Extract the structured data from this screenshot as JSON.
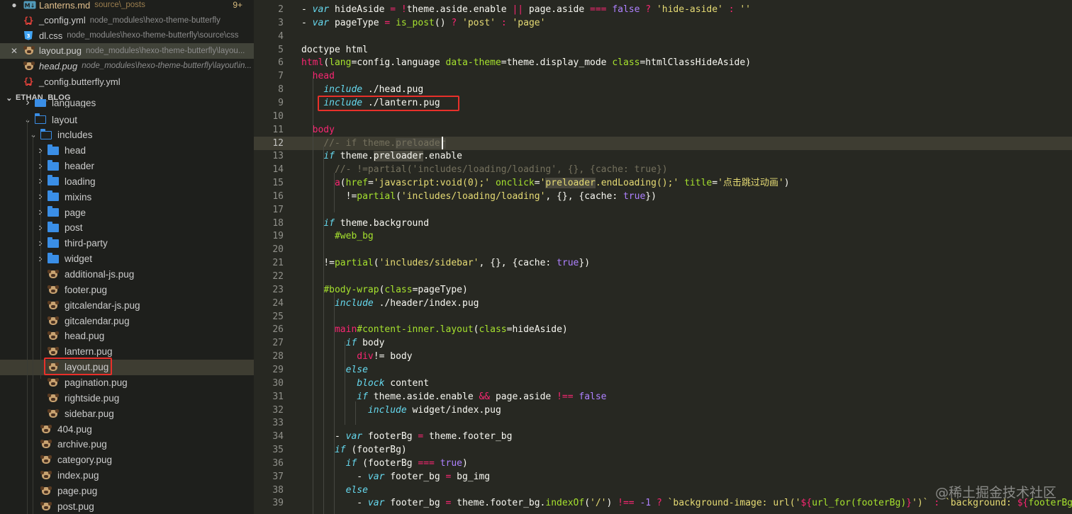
{
  "colors": {
    "sidebar_bg": "#1e1f1c",
    "editor_bg": "#272822",
    "highlight_box": "#e8302a",
    "folder": "#3a8ee6"
  },
  "open_editors": [
    {
      "name": "Lanterns.md",
      "desc": "source\\_posts",
      "badge": "9+",
      "icon": "markdown-icon",
      "lead": "●",
      "modified": true
    },
    {
      "name": "_config.yml",
      "desc": "node_modules\\hexo-theme-butterfly",
      "icon": "yaml-icon"
    },
    {
      "name": "dl.css",
      "desc": "node_modules\\hexo-theme-butterfly\\source\\css",
      "icon": "css-icon"
    },
    {
      "name": "layout.pug",
      "desc": "node_modules\\hexo-theme-butterfly\\layou...",
      "icon": "pug-icon",
      "lead": "✕",
      "active": true
    },
    {
      "name": "head.pug",
      "desc": "node_modules\\hexo-theme-butterfly\\layout\\in...",
      "icon": "pug-icon",
      "italic": true
    },
    {
      "name": "_config.butterfly.yml",
      "desc": "",
      "icon": "yaml-icon"
    }
  ],
  "project_header": "ETHAN_BLOG",
  "tree": [
    {
      "label": "languages",
      "type": "folder",
      "depth": 2,
      "partial": true
    },
    {
      "label": "layout",
      "type": "folder",
      "depth": 2,
      "open": true
    },
    {
      "label": "includes",
      "type": "folder",
      "depth": 3,
      "open": true
    },
    {
      "label": "head",
      "type": "folder",
      "depth": 4
    },
    {
      "label": "header",
      "type": "folder",
      "depth": 4
    },
    {
      "label": "loading",
      "type": "folder",
      "depth": 4
    },
    {
      "label": "mixins",
      "type": "folder",
      "depth": 4
    },
    {
      "label": "page",
      "type": "folder",
      "depth": 4
    },
    {
      "label": "post",
      "type": "folder",
      "depth": 4
    },
    {
      "label": "third-party",
      "type": "folder",
      "depth": 4
    },
    {
      "label": "widget",
      "type": "folder",
      "depth": 4
    },
    {
      "label": "additional-js.pug",
      "type": "pug",
      "depth": 4
    },
    {
      "label": "footer.pug",
      "type": "pug",
      "depth": 4
    },
    {
      "label": "gitcalendar-js.pug",
      "type": "pug",
      "depth": 4
    },
    {
      "label": "gitcalendar.pug",
      "type": "pug",
      "depth": 4
    },
    {
      "label": "head.pug",
      "type": "pug",
      "depth": 4
    },
    {
      "label": "lantern.pug",
      "type": "pug",
      "depth": 4
    },
    {
      "label": "layout.pug",
      "type": "pug",
      "depth": 4,
      "selected": true
    },
    {
      "label": "pagination.pug",
      "type": "pug",
      "depth": 4
    },
    {
      "label": "rightside.pug",
      "type": "pug",
      "depth": 4
    },
    {
      "label": "sidebar.pug",
      "type": "pug",
      "depth": 4
    },
    {
      "label": "404.pug",
      "type": "pug",
      "depth": 3
    },
    {
      "label": "archive.pug",
      "type": "pug",
      "depth": 3
    },
    {
      "label": "category.pug",
      "type": "pug",
      "depth": 3
    },
    {
      "label": "index.pug",
      "type": "pug",
      "depth": 3
    },
    {
      "label": "page.pug",
      "type": "pug",
      "depth": 3
    },
    {
      "label": "post.pug",
      "type": "pug",
      "depth": 3
    }
  ],
  "editor": {
    "current_line": 12,
    "lines": [
      {
        "n": 2,
        "tokens": [
          [
            "- ",
            ""
          ],
          [
            "var",
            "k"
          ],
          [
            " hideAside ",
            ""
          ],
          [
            "=",
            "op"
          ],
          [
            " ",
            ""
          ],
          [
            "!",
            "op"
          ],
          [
            "theme.aside.enable ",
            ""
          ],
          [
            "||",
            "op"
          ],
          [
            " page.aside ",
            ""
          ],
          [
            "===",
            "op"
          ],
          [
            " ",
            ""
          ],
          [
            "false",
            "n"
          ],
          [
            " ",
            ""
          ],
          [
            "?",
            "op"
          ],
          [
            " ",
            ""
          ],
          [
            "'hide-aside'",
            "s"
          ],
          [
            " ",
            ""
          ],
          [
            ":",
            "op"
          ],
          [
            " ",
            ""
          ],
          [
            "''",
            "s"
          ]
        ]
      },
      {
        "n": 3,
        "tokens": [
          [
            "- ",
            ""
          ],
          [
            "var",
            "k"
          ],
          [
            " pageType ",
            ""
          ],
          [
            "=",
            "op"
          ],
          [
            " ",
            ""
          ],
          [
            "is_post",
            "a"
          ],
          [
            "() ",
            ""
          ],
          [
            "?",
            "op"
          ],
          [
            " ",
            ""
          ],
          [
            "'post'",
            "s"
          ],
          [
            " ",
            ""
          ],
          [
            ":",
            "op"
          ],
          [
            " ",
            ""
          ],
          [
            "'page'",
            "s"
          ]
        ]
      },
      {
        "n": 4,
        "tokens": []
      },
      {
        "n": 5,
        "tokens": [
          [
            "doctype html",
            ""
          ]
        ]
      },
      {
        "n": 6,
        "tokens": [
          [
            "html",
            "t"
          ],
          [
            "(",
            ""
          ],
          [
            "lang",
            "a"
          ],
          [
            "=config.language ",
            ""
          ],
          [
            "data-theme",
            "a"
          ],
          [
            "=theme.display_mode ",
            ""
          ],
          [
            "class",
            "a"
          ],
          [
            "=htmlClassHideAside)",
            ""
          ]
        ]
      },
      {
        "n": 7,
        "tokens": [
          [
            "  ",
            ""
          ],
          [
            "head",
            "t"
          ]
        ]
      },
      {
        "n": 8,
        "tokens": [
          [
            "    ",
            ""
          ],
          [
            "include",
            "k"
          ],
          [
            " ./head.pug",
            ""
          ]
        ]
      },
      {
        "n": 9,
        "tokens": [
          [
            "    ",
            ""
          ],
          [
            "include",
            "k"
          ],
          [
            " ./lantern.pug",
            ""
          ]
        ]
      },
      {
        "n": 10,
        "tokens": []
      },
      {
        "n": 11,
        "tokens": [
          [
            "  ",
            ""
          ],
          [
            "body",
            "t"
          ]
        ]
      },
      {
        "n": 12,
        "tokens": [
          [
            "    ",
            ""
          ],
          [
            "//- if theme.",
            "c"
          ],
          [
            "preloader",
            "c hl"
          ]
        ]
      },
      {
        "n": 13,
        "tokens": [
          [
            "    ",
            ""
          ],
          [
            "if",
            "k"
          ],
          [
            " theme.",
            ""
          ],
          [
            "preloader",
            "hl"
          ],
          [
            ".enable",
            ""
          ]
        ]
      },
      {
        "n": 14,
        "tokens": [
          [
            "      ",
            ""
          ],
          [
            "//- !=partial('includes/loading/loading', {}, {cache: true})",
            "c"
          ]
        ]
      },
      {
        "n": 15,
        "tokens": [
          [
            "      ",
            ""
          ],
          [
            "a",
            "t"
          ],
          [
            "(",
            ""
          ],
          [
            "href",
            "a"
          ],
          [
            "=",
            ""
          ],
          [
            "'javascript:void(0);'",
            "s"
          ],
          [
            " ",
            ""
          ],
          [
            "onclick",
            "a"
          ],
          [
            "=",
            ""
          ],
          [
            "'",
            "s"
          ],
          [
            "preloader",
            "s hl"
          ],
          [
            ".endLoading();'",
            "s"
          ],
          [
            " ",
            ""
          ],
          [
            "title",
            "a"
          ],
          [
            "=",
            ""
          ],
          [
            "'点击跳过动画'",
            "s"
          ],
          [
            ")",
            ""
          ]
        ]
      },
      {
        "n": 16,
        "tokens": [
          [
            "        ",
            ""
          ],
          [
            "!=",
            ""
          ],
          [
            "partial",
            "a"
          ],
          [
            "(",
            ""
          ],
          [
            "'includes/loading/loading'",
            "s"
          ],
          [
            ", {}, {cache: ",
            ""
          ],
          [
            "true",
            "n"
          ],
          [
            "})",
            ""
          ]
        ]
      },
      {
        "n": 17,
        "tokens": []
      },
      {
        "n": 18,
        "tokens": [
          [
            "    ",
            ""
          ],
          [
            "if",
            "k"
          ],
          [
            " theme.background",
            ""
          ]
        ]
      },
      {
        "n": 19,
        "tokens": [
          [
            "      ",
            ""
          ],
          [
            "#web_bg",
            "a"
          ]
        ]
      },
      {
        "n": 20,
        "tokens": []
      },
      {
        "n": 21,
        "tokens": [
          [
            "    ",
            ""
          ],
          [
            "!=",
            ""
          ],
          [
            "partial",
            "a"
          ],
          [
            "(",
            ""
          ],
          [
            "'includes/sidebar'",
            "s"
          ],
          [
            ", {}, {cache: ",
            ""
          ],
          [
            "true",
            "n"
          ],
          [
            "})",
            ""
          ]
        ]
      },
      {
        "n": 22,
        "tokens": []
      },
      {
        "n": 23,
        "tokens": [
          [
            "    ",
            ""
          ],
          [
            "#body-wrap",
            "a"
          ],
          [
            "(",
            ""
          ],
          [
            "class",
            "a"
          ],
          [
            "=pageType)",
            ""
          ]
        ]
      },
      {
        "n": 24,
        "tokens": [
          [
            "      ",
            ""
          ],
          [
            "include",
            "k"
          ],
          [
            " ./header/index.pug",
            ""
          ]
        ]
      },
      {
        "n": 25,
        "tokens": []
      },
      {
        "n": 26,
        "tokens": [
          [
            "      ",
            ""
          ],
          [
            "main",
            "t"
          ],
          [
            "#content-inner.layout",
            "a"
          ],
          [
            "(",
            ""
          ],
          [
            "class",
            "a"
          ],
          [
            "=hideAside)",
            ""
          ]
        ]
      },
      {
        "n": 27,
        "tokens": [
          [
            "        ",
            ""
          ],
          [
            "if",
            "k"
          ],
          [
            " body",
            ""
          ]
        ]
      },
      {
        "n": 28,
        "tokens": [
          [
            "          ",
            ""
          ],
          [
            "div",
            "t"
          ],
          [
            "!= body",
            ""
          ]
        ]
      },
      {
        "n": 29,
        "tokens": [
          [
            "        ",
            ""
          ],
          [
            "else",
            "k"
          ]
        ]
      },
      {
        "n": 30,
        "tokens": [
          [
            "          ",
            ""
          ],
          [
            "block",
            "k"
          ],
          [
            " content",
            ""
          ]
        ]
      },
      {
        "n": 31,
        "tokens": [
          [
            "          ",
            ""
          ],
          [
            "if",
            "k"
          ],
          [
            " theme.aside.enable ",
            ""
          ],
          [
            "&&",
            "op"
          ],
          [
            " page.aside ",
            ""
          ],
          [
            "!==",
            "op"
          ],
          [
            " ",
            ""
          ],
          [
            "false",
            "n"
          ]
        ]
      },
      {
        "n": 32,
        "tokens": [
          [
            "            ",
            ""
          ],
          [
            "include",
            "k"
          ],
          [
            " widget/index.pug",
            ""
          ]
        ]
      },
      {
        "n": 33,
        "tokens": []
      },
      {
        "n": 34,
        "tokens": [
          [
            "      - ",
            ""
          ],
          [
            "var",
            "k"
          ],
          [
            " footerBg ",
            ""
          ],
          [
            "=",
            "op"
          ],
          [
            " theme.footer_bg",
            ""
          ]
        ]
      },
      {
        "n": 35,
        "tokens": [
          [
            "      ",
            ""
          ],
          [
            "if",
            "k"
          ],
          [
            " (footerBg)",
            ""
          ]
        ]
      },
      {
        "n": 36,
        "tokens": [
          [
            "        ",
            ""
          ],
          [
            "if",
            "k"
          ],
          [
            " (footerBg ",
            ""
          ],
          [
            "===",
            "op"
          ],
          [
            " ",
            ""
          ],
          [
            "true",
            "n"
          ],
          [
            ")",
            ""
          ]
        ]
      },
      {
        "n": 37,
        "tokens": [
          [
            "          - ",
            ""
          ],
          [
            "var",
            "k"
          ],
          [
            " footer_bg ",
            ""
          ],
          [
            "=",
            "op"
          ],
          [
            " bg_img",
            ""
          ]
        ]
      },
      {
        "n": 38,
        "tokens": [
          [
            "        ",
            ""
          ],
          [
            "else",
            "k"
          ]
        ]
      },
      {
        "n": 39,
        "tokens": [
          [
            "          - ",
            ""
          ],
          [
            "var",
            "k"
          ],
          [
            " footer_bg ",
            ""
          ],
          [
            "=",
            "op"
          ],
          [
            " theme.footer_bg.",
            ""
          ],
          [
            "indexOf",
            "a"
          ],
          [
            "(",
            ""
          ],
          [
            "'/'",
            "s"
          ],
          [
            ") ",
            ""
          ],
          [
            "!==",
            "op"
          ],
          [
            " ",
            ""
          ],
          [
            "-1",
            "n"
          ],
          [
            " ",
            ""
          ],
          [
            "?",
            "op"
          ],
          [
            " ",
            ""
          ],
          [
            "`background-image: url('",
            "s"
          ],
          [
            "${",
            "op"
          ],
          [
            "url_for(footerBg)",
            "a"
          ],
          [
            "}",
            "op"
          ],
          [
            "')`",
            "s"
          ],
          [
            " ",
            ""
          ],
          [
            ":",
            "op"
          ],
          [
            " ",
            ""
          ],
          [
            "`background: ",
            "s"
          ],
          [
            "${",
            "op"
          ],
          [
            "footerBg",
            "a"
          ],
          [
            "}",
            "op"
          ],
          [
            "`",
            "s"
          ]
        ]
      }
    ]
  },
  "watermark": "@稀土掘金技术社区"
}
